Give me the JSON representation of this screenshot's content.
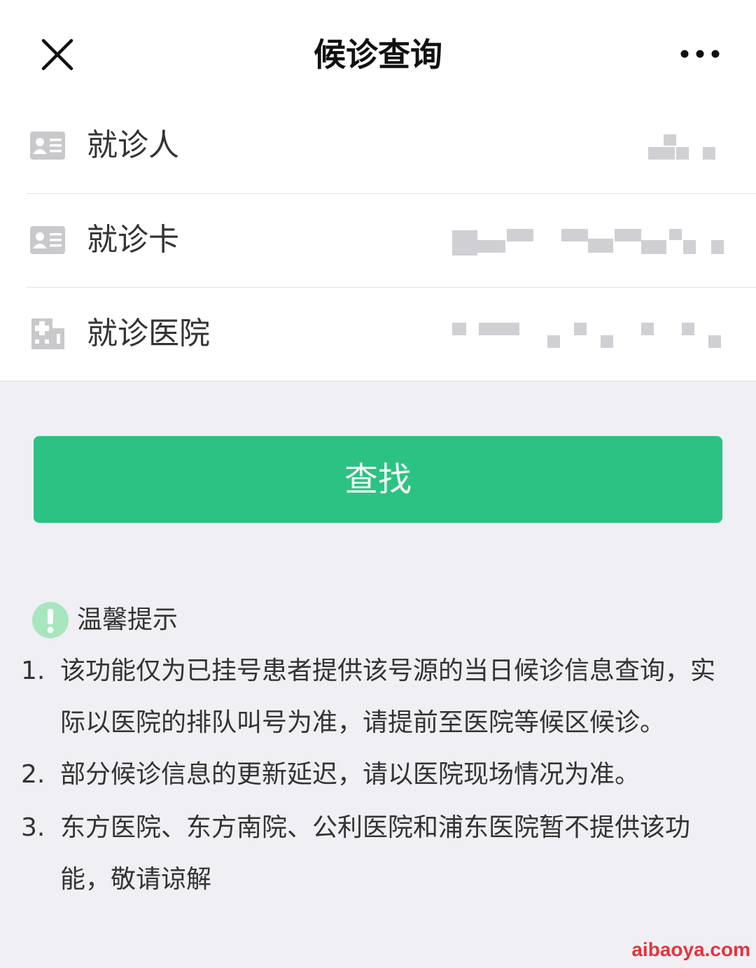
{
  "header": {
    "title": "候诊查询",
    "close_icon": "close-icon",
    "more_icon": "more-dots-icon"
  },
  "form": {
    "rows": [
      {
        "label": "就诊人",
        "icon": "id-card-icon"
      },
      {
        "label": "就诊卡",
        "icon": "id-card-icon"
      },
      {
        "label": "就诊医院",
        "icon": "hospital-icon"
      }
    ]
  },
  "search_button": {
    "label": "查找",
    "color": "#2cc283"
  },
  "tips": {
    "icon": "exclamation-icon",
    "title": "温馨提示",
    "items": [
      {
        "num": "1.",
        "text": "该功能仅为已挂号患者提供该号源的当日候诊信息查询，实际以医院的排队叫号为准，请提前至医院等候区候诊。"
      },
      {
        "num": "2.",
        "text": "部分候诊信息的更新延迟，请以医院现场情况为准。"
      },
      {
        "num": "3.",
        "text": "东方医院、东方南院、公利医院和浦东医院暂不提供该功能，敬请谅解"
      }
    ]
  },
  "watermark": "aibaoya.com"
}
